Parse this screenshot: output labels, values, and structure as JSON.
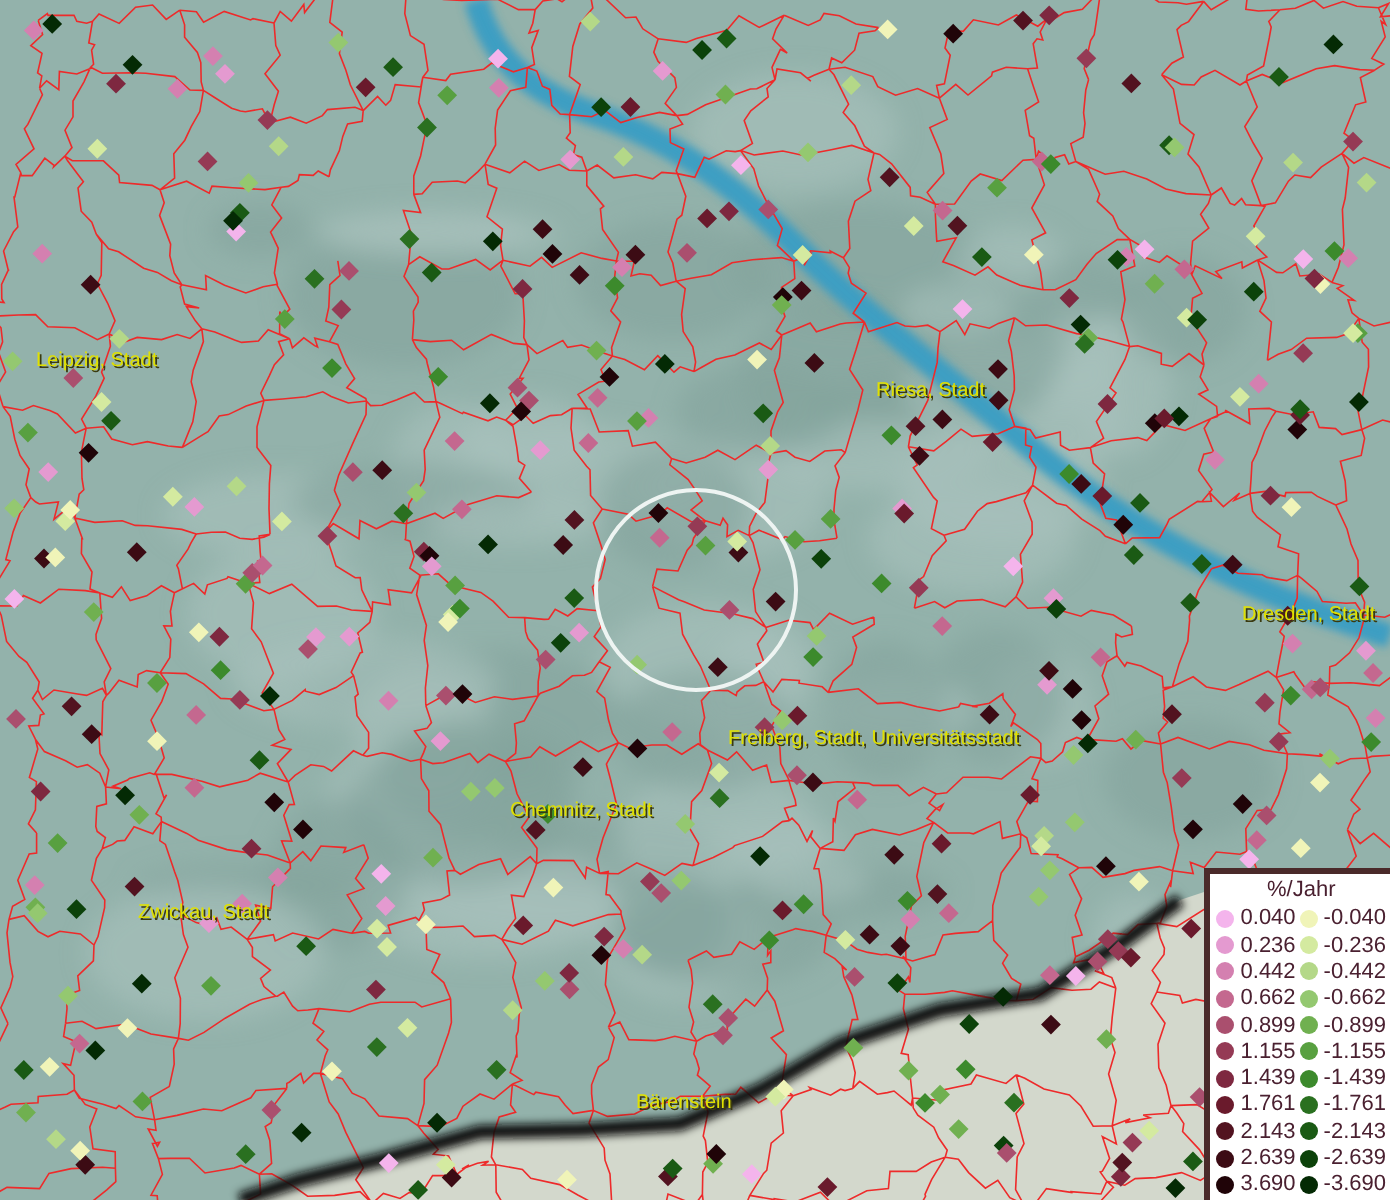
{
  "map": {
    "places": [
      {
        "label": "Leipzig, Stadt"
      },
      {
        "label": "Riesa, Stadt"
      },
      {
        "label": "Dresden, Stadt"
      },
      {
        "label": "Freiberg, Stadt, Universitätsstadt"
      },
      {
        "label": "Chemnitz, Stadt"
      },
      {
        "label": "Zwickau, Stadt"
      },
      {
        "label": "Bärenstein"
      }
    ]
  },
  "legend": {
    "title": "%/Jahr",
    "columns": [
      [
        {
          "label": "0.040",
          "color": "#f4b4ec"
        },
        {
          "label": "0.236",
          "color": "#e49ad0"
        },
        {
          "label": "0.442",
          "color": "#d480b0"
        },
        {
          "label": "0.662",
          "color": "#c4688f"
        },
        {
          "label": "0.899",
          "color": "#aa4f6e"
        },
        {
          "label": "1.155",
          "color": "#953a55"
        },
        {
          "label": "1.439",
          "color": "#7e2840"
        },
        {
          "label": "1.761",
          "color": "#6a1a2c"
        },
        {
          "label": "2.143",
          "color": "#521320"
        },
        {
          "label": "2.639",
          "color": "#3c0b14"
        },
        {
          "label": "3.690",
          "color": "#200408"
        }
      ],
      [
        {
          "label": "-0.040",
          "color": "#f0f4b8"
        },
        {
          "label": "-0.236",
          "color": "#d4eaa0"
        },
        {
          "label": "-0.442",
          "color": "#b4d888"
        },
        {
          "label": "-0.662",
          "color": "#94c870"
        },
        {
          "label": "-0.899",
          "color": "#70b050"
        },
        {
          "label": "-1.155",
          "color": "#58a040"
        },
        {
          "label": "-1.439",
          "color": "#3c8a2c"
        },
        {
          "label": "-1.761",
          "color": "#2a7020"
        },
        {
          "label": "-2.143",
          "color": "#1a5a14"
        },
        {
          "label": "-2.639",
          "color": "#0c420a"
        },
        {
          "label": "-3.690",
          "color": "#042a04"
        }
      ]
    ]
  }
}
